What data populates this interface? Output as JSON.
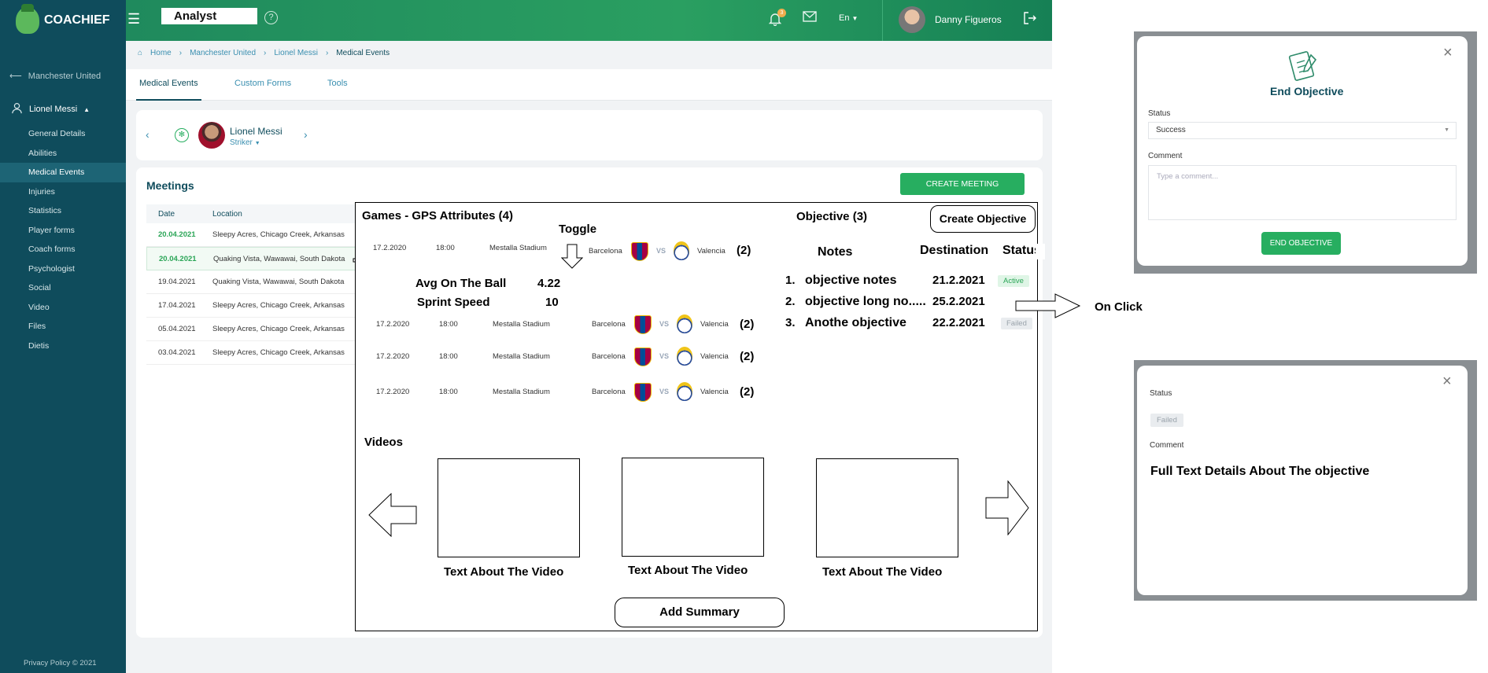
{
  "app": {
    "brand": "COACHIEF",
    "role": "Analyst",
    "notification_count": "3",
    "language": "En",
    "user_name": "Danny Figueros"
  },
  "sidebar": {
    "back_link": "Manchester United",
    "player": "Lionel Messi",
    "items": [
      {
        "label": "General Details"
      },
      {
        "label": "Abilities"
      },
      {
        "label": "Medical Events"
      },
      {
        "label": "Injuries"
      },
      {
        "label": "Statistics"
      },
      {
        "label": "Player forms"
      },
      {
        "label": "Coach forms"
      },
      {
        "label": "Psychologist"
      },
      {
        "label": "Social"
      },
      {
        "label": "Video"
      },
      {
        "label": "Files"
      },
      {
        "label": "Dietis"
      }
    ],
    "privacy": "Privacy Policy © 2021"
  },
  "breadcrumb": [
    "Home",
    "Manchester United",
    "Lionel Messi",
    "Medical Events"
  ],
  "tabs": [
    "Medical Events",
    "Custom Forms",
    "Tools"
  ],
  "player_card": {
    "name": "Lionel Messi",
    "position": "Striker"
  },
  "meetings": {
    "title": "Meetings",
    "create_label": "CREATE MEETING",
    "columns": [
      "Date",
      "Location"
    ],
    "rows": [
      {
        "date": "20.04.2021",
        "location": "Sleepy Acres, Chicago Creek, Arkansas"
      },
      {
        "date": "20.04.2021",
        "location": "Quaking Vista, Wawawai, South Dakota"
      },
      {
        "date": "19.04.2021",
        "location": "Quaking Vista, Wawawai, South Dakota"
      },
      {
        "date": "17.04.2021",
        "location": "Sleepy Acres, Chicago Creek, Arkansas"
      },
      {
        "date": "05.04.2021",
        "location": "Sleepy Acres, Chicago Creek, Arkansas"
      },
      {
        "date": "03.04.2021",
        "location": "Sleepy Acres, Chicago Creek, Arkansas"
      }
    ]
  },
  "wireframe": {
    "games_title": "Games - GPS Attributes (4)",
    "toggle_label": "Toggle",
    "games": [
      {
        "date": "17.2.2020",
        "time": "18:00",
        "stadium": "Mestalla Stadium",
        "home": "Barcelona",
        "vs": "VS",
        "away": "Valencia",
        "count": "(2)"
      },
      {
        "date": "17.2.2020",
        "time": "18:00",
        "stadium": "Mestalla Stadium",
        "home": "Barcelona",
        "vs": "VS",
        "away": "Valencia",
        "count": "(2)"
      },
      {
        "date": "17.2.2020",
        "time": "18:00",
        "stadium": "Mestalla Stadium",
        "home": "Barcelona",
        "vs": "VS",
        "away": "Valencia",
        "count": "(2)"
      },
      {
        "date": "17.2.2020",
        "time": "18:00",
        "stadium": "Mestalla Stadium",
        "home": "Barcelona",
        "vs": "VS",
        "away": "Valencia",
        "count": "(2)"
      }
    ],
    "attributes": [
      {
        "name": "Avg On The Ball",
        "value": "4.22"
      },
      {
        "name": "Sprint Speed",
        "value": "10"
      }
    ],
    "objective_title": "Objective (3)",
    "create_objective": "Create Objective",
    "objective_columns": [
      "Notes",
      "Destination",
      "Status"
    ],
    "objectives": [
      {
        "num": "1.",
        "note": "objective notes",
        "date": "21.2.2021",
        "status": "Active"
      },
      {
        "num": "2.",
        "note": "objective long no.....",
        "date": "25.2.2021",
        "status": ""
      },
      {
        "num": "3.",
        "note": "Anothe objective",
        "date": "22.2.2021",
        "status": "Failed"
      }
    ],
    "videos_title": "Videos",
    "video_caption": "Text About The Video",
    "add_summary": "Add Summary"
  },
  "on_click_label": "On Click",
  "end_objective_modal": {
    "title": "End Objective",
    "status_label": "Status",
    "status_value": "Success",
    "comment_label": "Comment",
    "comment_placeholder": "Type a comment...",
    "button": "END OBJECTIVE"
  },
  "detail_modal": {
    "status_label": "Status",
    "status_value": "Failed",
    "comment_label": "Comment",
    "comment_text": "Full Text Details About The objective"
  },
  "colors": {
    "sidebar": "#0f4c5c",
    "topbar": "#2a9f61",
    "accent": "#27ae60",
    "link": "#3a8fb0"
  }
}
